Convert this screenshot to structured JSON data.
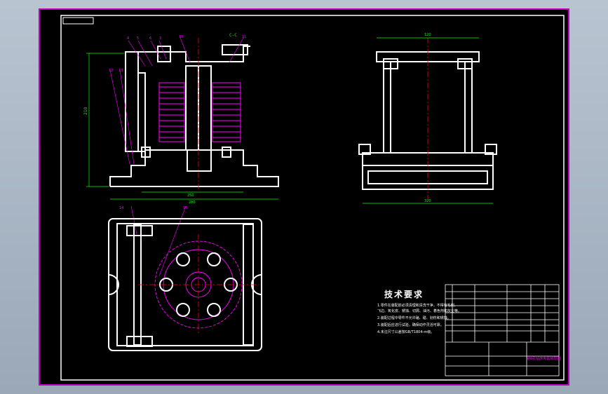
{
  "drawing": {
    "technical_requirements_title": "技术要求",
    "section_view_label": "C-C",
    "technical_notes": [
      "1.零件在装配前必须清理和清洗干净，不得有毛刺、",
      "飞边、氧化皮、锈蚀、切屑、油污、着色剂和灰尘等。",
      "2.装配过程中零件不允许磕、碰、划伤和锈蚀。",
      "3.装配后应进行试验，确保动作灵活可靠。",
      "4.未注尺寸公差按GB/T1804-m级。"
    ],
    "title_block_name": "钻6孔钻床夹具装配图",
    "part_numbers": [
      "4",
      "5",
      "6",
      "3",
      "7",
      "8",
      "9",
      "10",
      "11",
      "12",
      "13",
      "14",
      "15"
    ],
    "dimensions": {
      "height": "210",
      "width_front": "280",
      "width_side": "120",
      "side_base": "320",
      "base_front": "250"
    }
  },
  "colors": {
    "frame": "#c000c0",
    "outline": "#ffffff",
    "hatch": "#ff00ff",
    "center": "#ff0000",
    "dimension": "#00ff00",
    "background": "#000000"
  }
}
